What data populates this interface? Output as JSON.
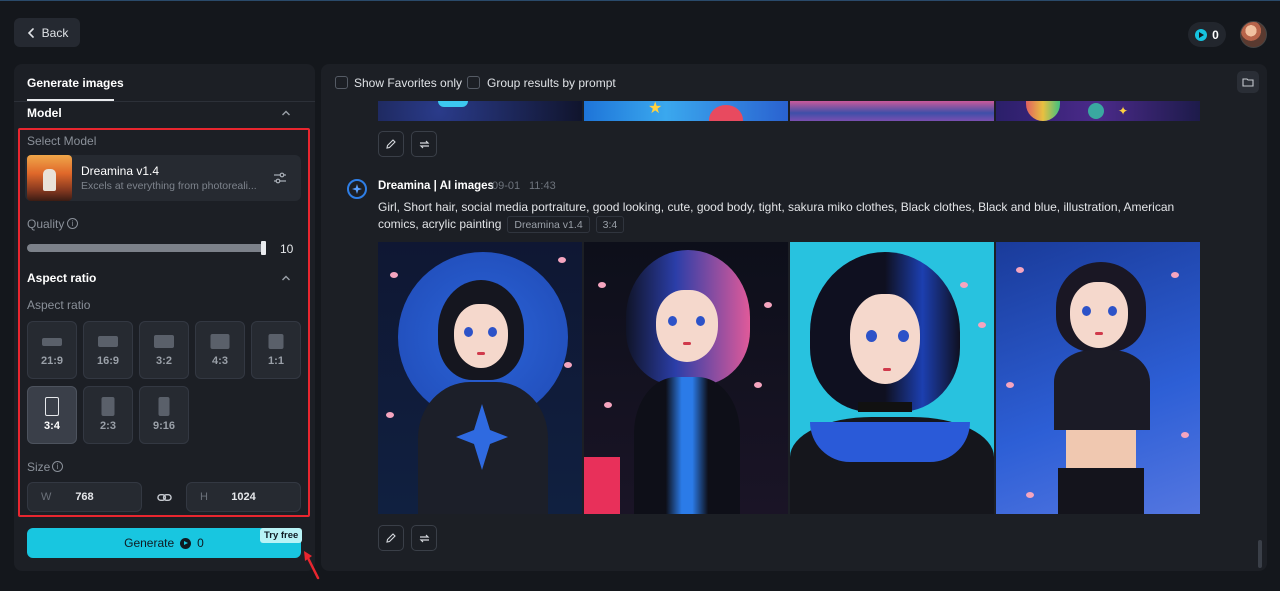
{
  "nav": {
    "back_label": "Back"
  },
  "account": {
    "credits": "0"
  },
  "left_panel": {
    "tab_label": "Generate images",
    "model_section": {
      "title": "Model",
      "select_label": "Select Model",
      "model_name": "Dreamina v1.4",
      "model_desc": "Excels at everything from photoreali..."
    },
    "quality": {
      "label": "Quality",
      "value": "10",
      "fraction": 1.0
    },
    "aspect_section": {
      "title": "Aspect ratio",
      "label": "Aspect ratio",
      "options": [
        "21:9",
        "16:9",
        "3:2",
        "4:3",
        "1:1",
        "3:4",
        "2:3",
        "9:16"
      ],
      "selected": "3:4"
    },
    "size": {
      "label": "Size",
      "width_prefix": "W",
      "width": "768",
      "height_prefix": "H",
      "height": "1024"
    },
    "generate": {
      "label": "Generate",
      "cost": "0",
      "badge": "Try free"
    }
  },
  "results": {
    "filters": {
      "favorites_label": "Show Favorites only",
      "group_label": "Group results by prompt"
    },
    "entry": {
      "author": "Dreamina | AI images",
      "date": "09-01",
      "time": "11:43",
      "prompt": "Girl, Short hair, social media portraiture, good looking, cute, good body, tight, sakura miko clothes, Black clothes, Black and blue, illustration, American comics, acrylic painting",
      "tags": [
        "Dreamina v1.4",
        "3:4"
      ]
    }
  },
  "colors": {
    "accent": "#18c6e0",
    "highlight_border": "#e8262f",
    "panel_bg": "#1c1f25",
    "page_bg": "#14171c"
  },
  "icons": {
    "back": "chevron-left-icon",
    "credit": "credit-icon",
    "settings": "sliders-icon",
    "info": "info-icon",
    "link": "link-icon",
    "edit": "pencil-icon",
    "regenerate": "repeat-icon",
    "folder": "folder-icon",
    "collapse": "chevron-up-icon"
  }
}
